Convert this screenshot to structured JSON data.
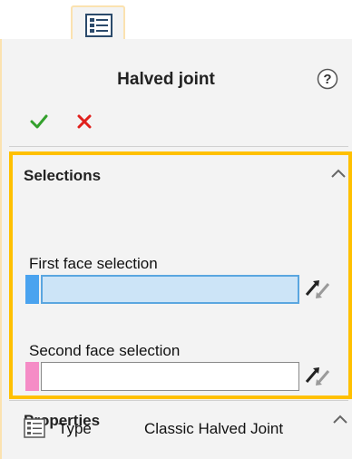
{
  "tabs": [
    {
      "icon": "property-manager-icon",
      "active": true
    }
  ],
  "header": {
    "title": "Halved joint",
    "help_icon": "help-icon"
  },
  "actions": {
    "ok_icon": "checkmark-icon",
    "cancel_icon": "close-icon"
  },
  "selections": {
    "heading": "Selections",
    "fields": [
      {
        "label": "First face selection",
        "value": "",
        "swatch_color": "#4aa3ef",
        "active": true
      },
      {
        "label": "Second face selection",
        "value": "",
        "swatch_color": "#f58cc6",
        "active": false
      }
    ]
  },
  "properties": {
    "heading": "Properties",
    "rows": [
      {
        "key": "Type",
        "value": "Classic Halved Joint",
        "icon": "list-icon"
      }
    ]
  },
  "colors": {
    "highlight_border": "#ffc000",
    "panel_bg": "#f3f3f3",
    "ok": "#33a02c",
    "cancel": "#e0201c"
  }
}
